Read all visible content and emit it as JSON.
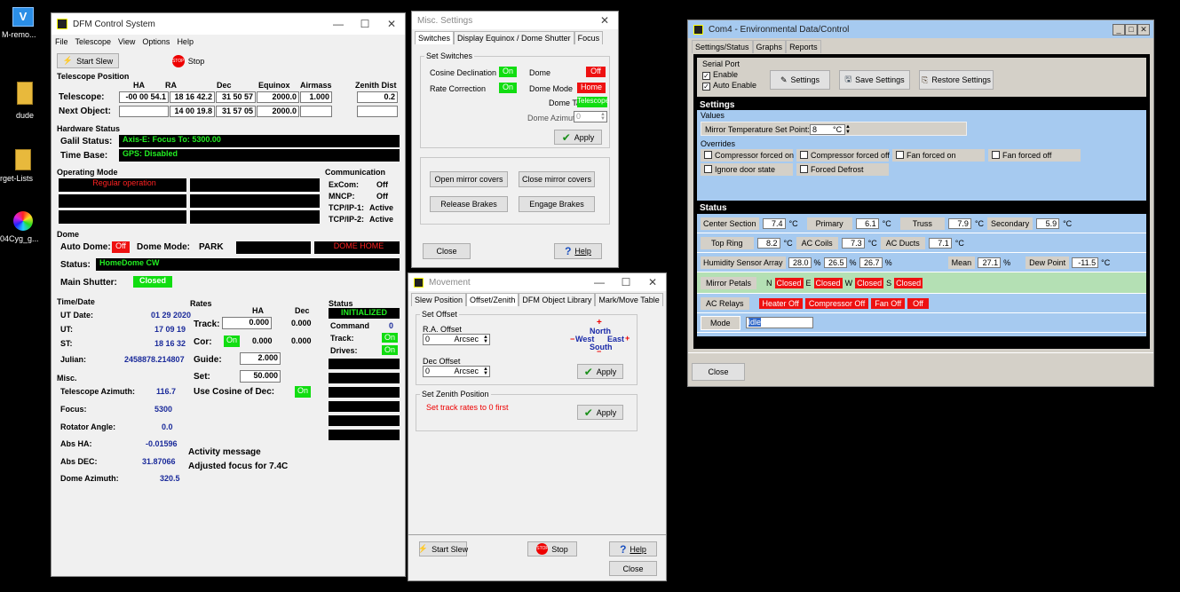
{
  "desktop": {
    "icons": [
      "M-remo...",
      "dude",
      "rget-Lists",
      "04Cyg_g..."
    ]
  },
  "dfm": {
    "title": "DFM Control System",
    "menu": [
      "File",
      "Telescope",
      "View",
      "Options",
      "Help"
    ],
    "start_slew": "Start Slew",
    "stop": "Stop",
    "tp_header": "Telescope Position",
    "cols": [
      "HA",
      "RA",
      "Dec",
      "Equinox",
      "Airmass",
      "Zenith Dist"
    ],
    "telescope_label": "Telescope:",
    "telescope": [
      "-00 00 54.1",
      "18 16 42.2",
      "31 50 57",
      "2000.0",
      "1.000",
      "0.2"
    ],
    "next_label": "Next Object:",
    "next": [
      "",
      "14 00 19.8",
      "31 57 05",
      "2000.0",
      "",
      ""
    ],
    "hw_header": "Hardware Status",
    "galil_label": "Galil Status:",
    "galil": "Axis-E: Focus To: 5300.00",
    "timebase_label": "Time Base:",
    "timebase": "GPS: Disabled",
    "op_header": "Operating Mode",
    "op_mode": "Regular operation",
    "comm_header": "Communication",
    "comm": [
      {
        "k": "ExCom:",
        "v": "Off"
      },
      {
        "k": "MNCP:",
        "v": "Off"
      },
      {
        "k": "TCP/IP-1:",
        "v": "Active"
      },
      {
        "k": "TCP/IP-2:",
        "v": "Active"
      }
    ],
    "dome_header": "Dome",
    "auto_dome_label": "Auto Dome:",
    "auto_dome": "Off",
    "dome_mode_label": "Dome Mode:",
    "dome_mode": "PARK",
    "dome_home": "DOME HOME",
    "status_label": "Status:",
    "status": "HomeDome CW",
    "shutter_label": "Main Shutter:",
    "shutter": "Closed",
    "time_header": "Time/Date",
    "time": [
      {
        "k": "UT Date:",
        "v": "01 29 2020"
      },
      {
        "k": "UT:",
        "v": "17 09 19"
      },
      {
        "k": "ST:",
        "v": "18 16 32"
      },
      {
        "k": "Julian:",
        "v": "2458878.214807"
      }
    ],
    "misc_header": "Misc.",
    "misc": [
      {
        "k": "Telescope Azimuth:",
        "v": "116.7"
      },
      {
        "k": "Focus:",
        "v": "5300"
      },
      {
        "k": "Rotator Angle:",
        "v": "0.0"
      },
      {
        "k": "Abs HA:",
        "v": "-0.01596"
      },
      {
        "k": "Abs DEC:",
        "v": "31.87066"
      },
      {
        "k": "Dome Azimuth:",
        "v": "320.5"
      }
    ],
    "rates_header": "Rates",
    "rates_ha": "HA",
    "rates_dec": "Dec",
    "track_label": "Track:",
    "track_ha": "0.000",
    "track_dec": "0.000",
    "cor_label": "Cor:",
    "cor_state": "On",
    "cor_ha": "0.000",
    "cor_dec": "0.000",
    "guide_label": "Guide:",
    "guide": "2.000",
    "set_label": "Set:",
    "set": "50.000",
    "cosine_label": "Use Cosine of Dec:",
    "cosine_state": "On",
    "st_header": "Status",
    "st_init": "INITIALIZED",
    "st_rows": [
      {
        "k": "Command",
        "v": "0"
      },
      {
        "k": "Track:",
        "v": "On"
      },
      {
        "k": "Drives:",
        "v": "On"
      }
    ],
    "activity_header": "Activity message",
    "activity": "Adjusted focus for 7.4C"
  },
  "misc_settings": {
    "title": "Misc. Settings",
    "tabs": [
      "Switches",
      "Display Equinox / Dome Shutter",
      "Focus"
    ],
    "group": "Set Switches",
    "cos_dec": "Cosine Declination",
    "cos_dec_v": "On",
    "rate_corr": "Rate Correction",
    "rate_corr_v": "On",
    "dome": "Dome",
    "dome_v": "Off",
    "dome_mode": "Dome Mode",
    "dome_mode_v": "Home",
    "dome_target": "Dome Target",
    "dome_target_v": "Telescope",
    "dome_az": "Dome Azimuth:",
    "dome_az_v": "0",
    "apply": "Apply",
    "open_covers": "Open mirror covers",
    "close_covers": "Close mirror covers",
    "release_brakes": "Release Brakes",
    "engage_brakes": "Engage Brakes",
    "close": "Close",
    "help": "Help"
  },
  "movement": {
    "title": "Movement",
    "tabs": [
      "Slew Position",
      "Offset/Zenith",
      "DFM Object Library",
      "Mark/Move Table"
    ],
    "set_offset": "Set Offset",
    "ra_offset": "R.A. Offset",
    "ra_val": "0",
    "unit": "Arcsec",
    "dec_offset": "Dec Offset",
    "dec_val": "0",
    "north": "North",
    "west": "West",
    "east": "East",
    "south": "South",
    "apply": "Apply",
    "zenith_header": "Set Zenith Position",
    "zenith_msg": "Set track rates to 0 first",
    "start_slew": "Start Slew",
    "stop": "Stop",
    "help": "Help",
    "close": "Close"
  },
  "com4": {
    "title": "Com4 - Environmental Data/Control",
    "tabs": [
      "Settings/Status",
      "Graphs",
      "Reports"
    ],
    "serial_port": "Serial Port",
    "enable": "Enable",
    "auto_enable": "Auto Enable",
    "settings_btn": "Settings",
    "save_btn": "Save Settings",
    "restore_btn": "Restore Settings",
    "settings_header": "Settings",
    "values": "Values",
    "mirror_temp_label": "Mirror Temperature Set Point:",
    "mirror_temp": "8",
    "deg_c": "°C",
    "overrides": "Overrides",
    "ov": [
      "Compressor forced on",
      "Compressor forced off",
      "Fan forced on",
      "Fan forced off",
      "Ignore door state",
      "Forced Defrost"
    ],
    "status_header": "Status",
    "temps1": [
      {
        "k": "Center Section",
        "v": "7.4"
      },
      {
        "k": "Primary",
        "v": "6.1"
      },
      {
        "k": "Truss",
        "v": "7.9"
      },
      {
        "k": "Secondary",
        "v": "5.9"
      }
    ],
    "temps2": [
      {
        "k": "Top Ring",
        "v": "8.2"
      },
      {
        "k": "AC Coils",
        "v": "7.3"
      },
      {
        "k": "AC Ducts",
        "v": "7.1"
      }
    ],
    "humidity_label": "Humidity Sensor Array",
    "hum": [
      "28.0",
      "26.5",
      "26.7"
    ],
    "pct": "%",
    "mean_label": "Mean",
    "mean": "27.1",
    "dew_label": "Dew Point",
    "dew": "-11.5",
    "petals_label": "Mirror Petals",
    "petals": [
      {
        "d": "N",
        "v": "Closed"
      },
      {
        "d": "E",
        "v": "Closed"
      },
      {
        "d": "W",
        "v": "Closed"
      },
      {
        "d": "S",
        "v": "Closed"
      }
    ],
    "relays_label": "AC Relays",
    "relays": [
      "Heater Off",
      "Compressor Off",
      "Fan Off",
      "Off"
    ],
    "mode_label": "Mode",
    "mode": "Idle",
    "close": "Close"
  }
}
